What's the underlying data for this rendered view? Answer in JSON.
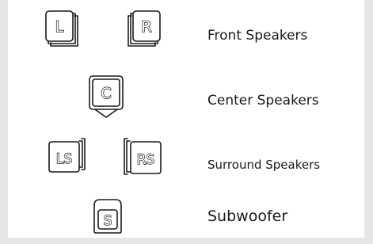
{
  "rows": [
    {
      "label": "Front Speakers",
      "icons": [
        "front-left-speaker-icon",
        "front-right-speaker-icon"
      ],
      "glyphs": [
        "L",
        "R"
      ]
    },
    {
      "label": "Center Speakers",
      "icons": [
        "center-speaker-icon"
      ],
      "glyphs": [
        "C"
      ]
    },
    {
      "label": "Surround Speakers",
      "icons": [
        "surround-left-speaker-icon",
        "surround-right-speaker-icon"
      ],
      "glyphs": [
        "LS",
        "RS"
      ]
    },
    {
      "label": "Subwoofer",
      "icons": [
        "subwoofer-icon"
      ],
      "glyphs": [
        "S"
      ]
    }
  ],
  "colors": {
    "background": "#e6e6e6",
    "panel": "#ffffff",
    "ink": "#1a1a1a"
  }
}
